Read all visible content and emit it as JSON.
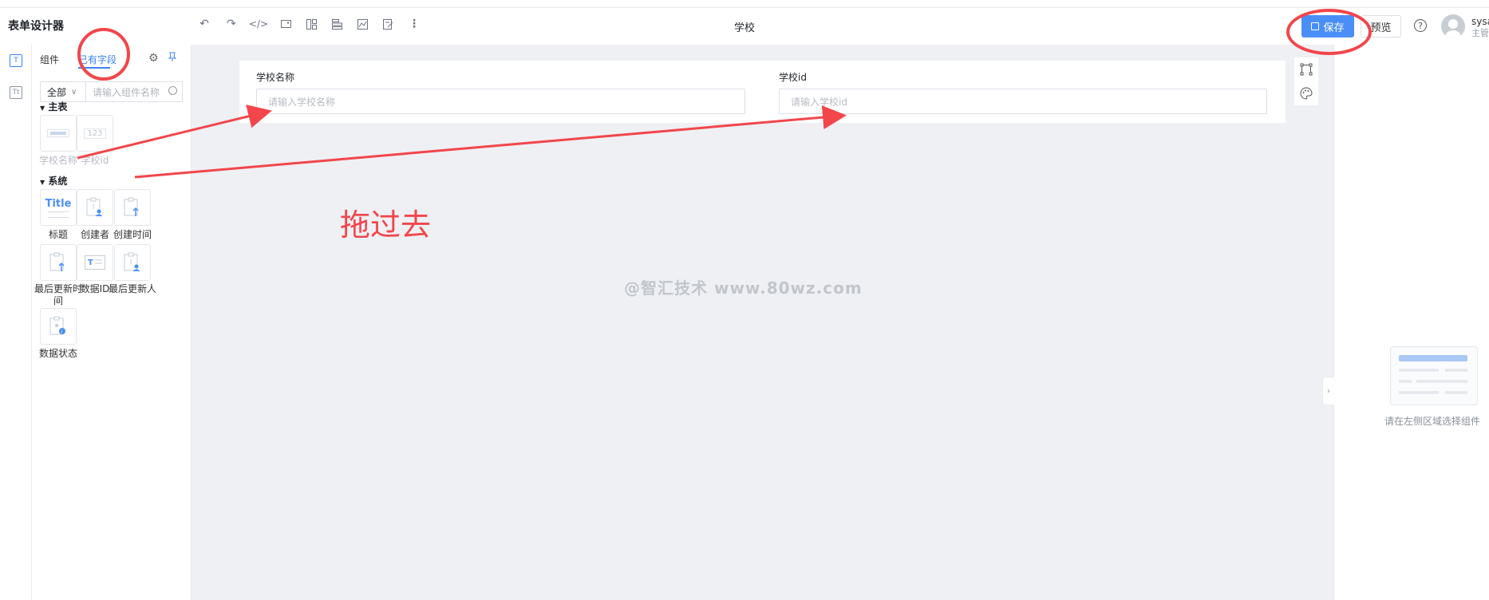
{
  "app": {
    "title": "表单设计器"
  },
  "toolbar": {
    "icons": [
      "undo-icon",
      "redo-icon",
      "code-icon",
      "image-icon",
      "layout-icon",
      "list-icon",
      "chart-icon",
      "edit-icon",
      "more-icon"
    ]
  },
  "form": {
    "name": "学校",
    "fields": [
      {
        "label": "学校名称",
        "placeholder": "请输入学校名称"
      },
      {
        "label": "学校id",
        "placeholder": "请输入学校id"
      }
    ]
  },
  "header_actions": {
    "save_label": "保存",
    "preview_label": "预览",
    "help_icon": "?"
  },
  "user": {
    "name": "sysa",
    "role": "主管"
  },
  "panel": {
    "tabs": [
      "组件",
      "已有字段"
    ],
    "active_tab": 1,
    "scope": "全部",
    "search_placeholder": "请输入组件名称",
    "groups": [
      {
        "title": "主表",
        "items": [
          {
            "label": "学校名称",
            "glyph": ""
          },
          {
            "label": "学校id",
            "glyph": "123"
          }
        ]
      },
      {
        "title": "系统",
        "items": [
          {
            "label": "标题",
            "glyph": "Title"
          },
          {
            "label": "创建者",
            "glyph": ""
          },
          {
            "label": "创建时间",
            "glyph": ""
          },
          {
            "label": "最后更新时间",
            "glyph": ""
          },
          {
            "label": "数据ID",
            "glyph": "T"
          },
          {
            "label": "最后更新人",
            "glyph": ""
          },
          {
            "label": "数据状态",
            "glyph": ""
          }
        ]
      }
    ]
  },
  "canvas": {
    "watermark": "@智汇技术 www.80wz.com"
  },
  "annotation": {
    "text": "拖过去",
    "color": "#f2464b"
  },
  "right_panel": {
    "empty_text": "请在左侧区域选择组件"
  },
  "colors": {
    "accent": "#3b82f6",
    "save_button": "#4a8ff7",
    "canvas_bg": "#eef0f4",
    "annotation_red": "#f2464b"
  }
}
